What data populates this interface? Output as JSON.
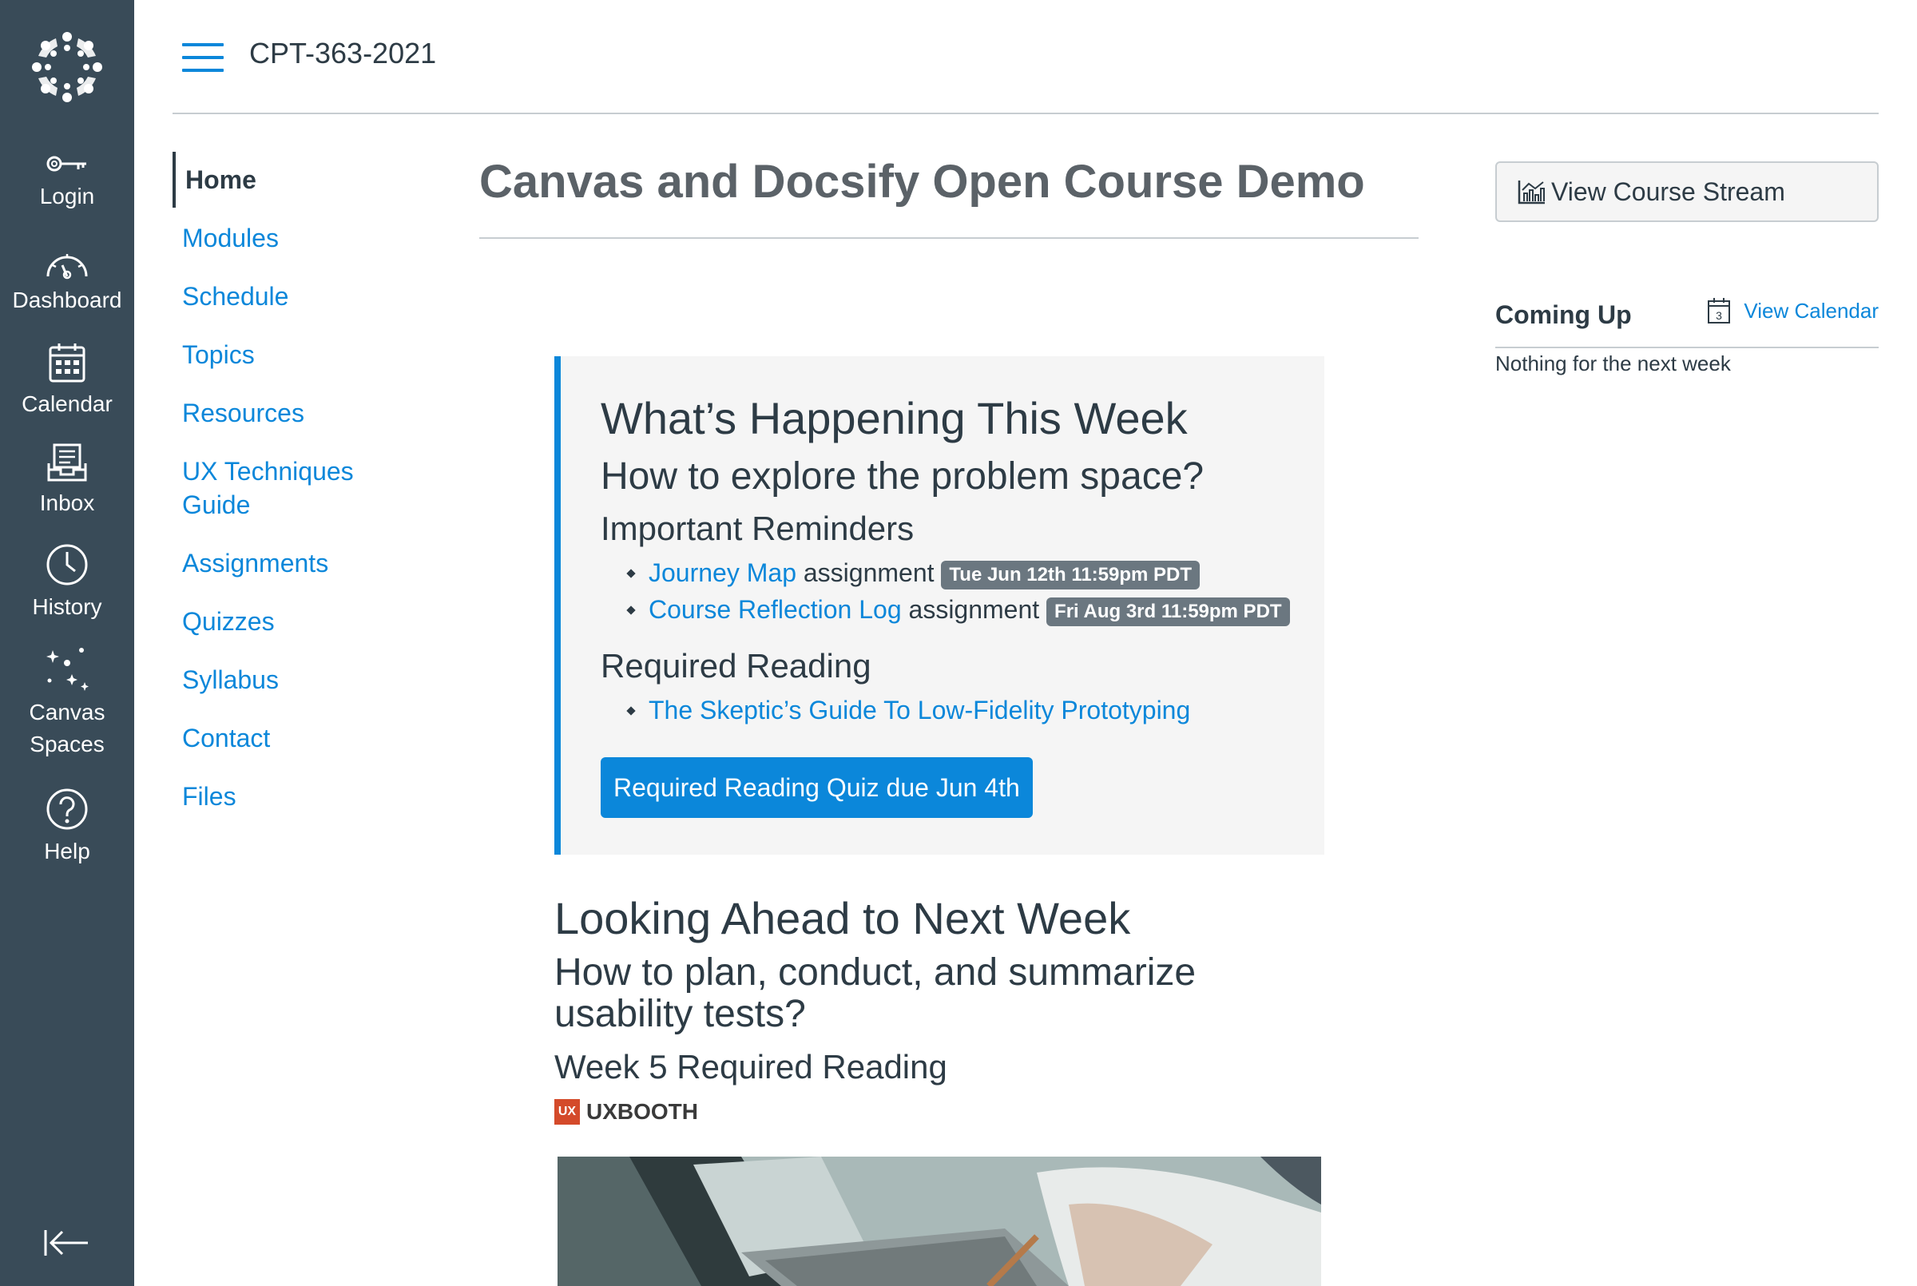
{
  "global_nav": {
    "items": [
      {
        "label": "Login",
        "icon": "key-icon"
      },
      {
        "label": "Dashboard",
        "icon": "dashboard-icon"
      },
      {
        "label": "Calendar",
        "icon": "calendar-icon"
      },
      {
        "label": "Inbox",
        "icon": "inbox-icon"
      },
      {
        "label": "History",
        "icon": "clock-icon"
      },
      {
        "label": "Canvas Spaces",
        "icon": "sparkles-icon"
      },
      {
        "label": "Help",
        "icon": "help-icon"
      }
    ]
  },
  "header": {
    "course_code": "CPT-363-2021"
  },
  "course_nav": {
    "items": [
      {
        "label": "Home",
        "active": true
      },
      {
        "label": "Modules"
      },
      {
        "label": "Schedule"
      },
      {
        "label": "Topics"
      },
      {
        "label": "Resources"
      },
      {
        "label": "UX Techniques Guide"
      },
      {
        "label": "Assignments"
      },
      {
        "label": "Quizzes"
      },
      {
        "label": "Syllabus"
      },
      {
        "label": "Contact"
      },
      {
        "label": "Files"
      }
    ]
  },
  "main": {
    "title": "Canvas and Docsify Open Course Demo",
    "this_week": {
      "heading": "What’s Happening This Week",
      "question": "How to explore the problem space?",
      "reminders_heading": "Important Reminders",
      "reminders": [
        {
          "link": "Journey Map",
          "suffix": "assignment",
          "due": "Tue Jun 12th 11:59pm PDT"
        },
        {
          "link": "Course Reflection Log",
          "suffix": "assignment",
          "due": "Fri Aug 3rd 11:59pm PDT"
        }
      ],
      "reading_heading": "Required Reading",
      "readings": [
        {
          "link": "The Skeptic’s Guide To Low-Fidelity Prototyping"
        }
      ],
      "quiz_button": "Required Reading Quiz due Jun 4th"
    },
    "next_week": {
      "heading": "Looking Ahead to Next Week",
      "question": "How to plan, conduct, and summarize usability tests?",
      "reading_heading": "Week 5 Required Reading",
      "source_logo": "UX",
      "source_name": "UXBOOTH"
    }
  },
  "sidebar": {
    "stream_button": "View Course Stream",
    "coming_up_title": "Coming Up",
    "view_calendar": "View Calendar",
    "calendar_icon_day": "3",
    "empty_message": "Nothing for the next week"
  },
  "colors": {
    "nav_bg": "#394b58",
    "link": "#0b87da",
    "text": "#2d3b45",
    "badge": "#6b7780"
  }
}
